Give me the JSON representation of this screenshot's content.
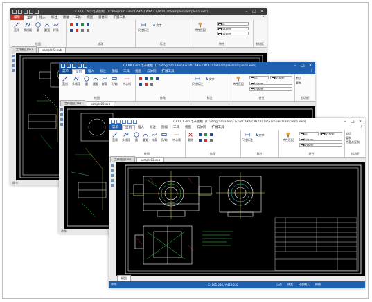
{
  "app": {
    "title_text": "CAXA CAD 电子图板",
    "path_text": "[C:\\Program Files\\CAXA\\CAXA CAD\\2018\\Samples\\sample01.exb]",
    "menu_items": [
      "菜单",
      "常用",
      "插入",
      "标注",
      "图幅",
      "工具",
      "视图",
      "云协同",
      "扩展工具"
    ],
    "help_icon": "?",
    "ribbon_groups": {
      "draw": "绘图",
      "modify": "修改",
      "annotate": "标注",
      "properties": "特性",
      "clipboard": "剪切板"
    },
    "draw_tools": [
      "直线",
      "多线段",
      "圆",
      "圆弧",
      "样条",
      "孔/轴",
      "中心线"
    ],
    "modify_tools": [
      "删除",
      "平移",
      "镜像",
      "旋转",
      "复制",
      "裁剪"
    ],
    "annotate_tools": [
      "尺寸标注",
      "文字",
      "坐标标注",
      "符号"
    ],
    "props_tools": [
      "特性匹配"
    ],
    "layer_name": "0层",
    "bylayer": "ByLayer",
    "clipboard_tools": [
      "粘贴",
      "剪切",
      "复制",
      "带基点复制"
    ],
    "file_tabs": [
      "工作图区(Sk)",
      "sample02.exb"
    ],
    "layout_tab": "模型",
    "command_prompt": "命令:",
    "coordinates": "X:-161.286, Y:419.132",
    "status_right": [
      "正交",
      "线宽",
      "动态输入",
      "栅格"
    ]
  },
  "colors": {
    "dark_titlebar": "#3c3c3c",
    "blue_titlebar": "#1e5faf",
    "status_blue": "#1e5faf",
    "file_tab_red": "#c0392b",
    "frame_teal": "#8fd0cf",
    "cad_black": "#000000",
    "cad_white": "#ffffff",
    "cad_green": "#3fd34a",
    "cad_yellow": "#f0e042",
    "cad_red": "#e13b3b",
    "cad_cyan": "#39d9e0"
  }
}
